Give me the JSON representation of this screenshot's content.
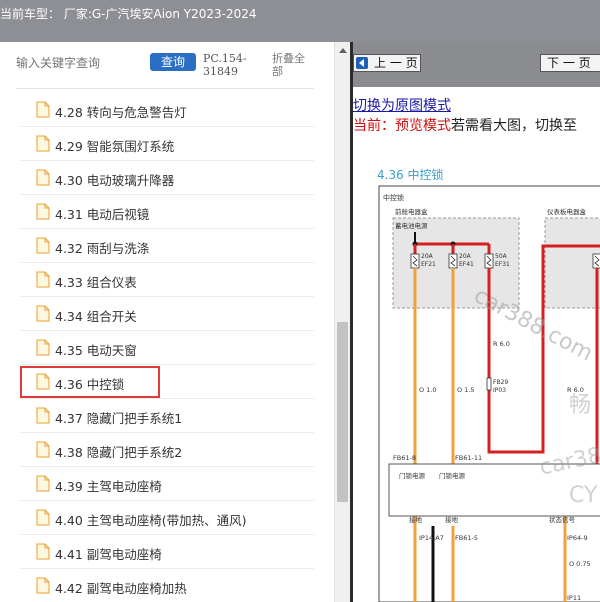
{
  "header": {
    "title": "当前车型： 厂家:G-广汽埃安Aion Y2023-2024"
  },
  "left": {
    "search_placeholder": "输入关键字查询",
    "search_button": "查询",
    "code": "PC.154-31849",
    "collapse_all": "折叠全部",
    "items": [
      {
        "label": "4.28 转向与危急警告灯"
      },
      {
        "label": "4.29 智能氛围灯系统"
      },
      {
        "label": "4.30 电动玻璃升降器"
      },
      {
        "label": "4.31 电动后视镜"
      },
      {
        "label": "4.32 雨刮与洗涤"
      },
      {
        "label": "4.33 组合仪表"
      },
      {
        "label": "4.34 组合开关"
      },
      {
        "label": "4.35 电动天窗"
      },
      {
        "label": "4.36 中控锁"
      },
      {
        "label": "4.37 隐藏门把手系统1"
      },
      {
        "label": "4.38 隐藏门把手系统2"
      },
      {
        "label": "4.39 主驾电动座椅"
      },
      {
        "label": "4.40 主驾电动座椅(带加热、通风)"
      },
      {
        "label": "4.41 副驾电动座椅"
      },
      {
        "label": "4.42 副驾电动座椅加热"
      }
    ],
    "selected_index": 8
  },
  "right": {
    "prev_button": "上 一 页",
    "next_button": "下 一 页",
    "switch_link": "切换为原图模式",
    "preview_current": "当前：",
    "preview_mode": "预览模式",
    "preview_hint": "若需看大图，切换至",
    "section_title": "4.36 中控锁",
    "diagram": {
      "heading": "中控锁",
      "front_box_label": "前舱电器盒",
      "battery_label": "蓄电池电源",
      "ip_box_label": "仪表板电器盒",
      "fuses": [
        {
          "amp": "20A",
          "name": "EF21"
        },
        {
          "amp": "20A",
          "name": "EF41"
        },
        {
          "amp": "50A",
          "name": "EF31"
        }
      ],
      "wire_labels": [
        "O 1.0",
        "O 1.5",
        "R 6.0",
        "R 6.0"
      ],
      "connectors": [
        "FB29",
        "IP03",
        "FB61-8",
        "FB61-11",
        "IP14-A7",
        "FB61-5",
        "IP64-9",
        "IP11"
      ],
      "module_labels": [
        "门锁电源",
        "门锁电源",
        "接地",
        "接地",
        "状态信号"
      ],
      "bottom_wire": "O 0.75",
      "watermarks": [
        "car388.com",
        "畅",
        "car38",
        "CY"
      ],
      "accent_colors": {
        "red_wire": "#d42020",
        "orange_wire": "#f0a040",
        "black_wire": "#111111"
      }
    }
  }
}
